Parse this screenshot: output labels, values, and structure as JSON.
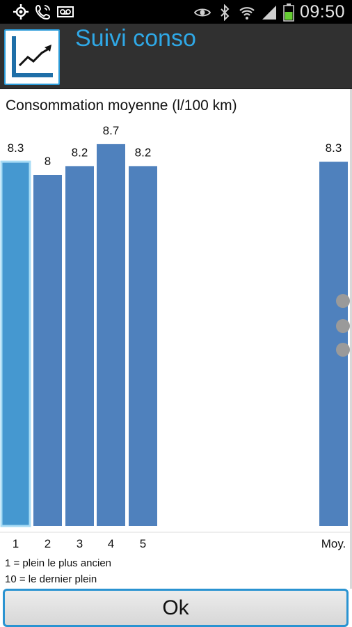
{
  "status_bar": {
    "time": "09:50",
    "icons_left": [
      "gps-icon",
      "call-icon",
      "voicemail-icon"
    ],
    "icons_right": [
      "eye-icon",
      "bluetooth-icon",
      "wifi-icon",
      "signal-icon",
      "battery-icon"
    ]
  },
  "app": {
    "title": "Suivi conso",
    "icon": "chart-trend-icon",
    "accent_color": "#2fa8e6"
  },
  "chart_data": {
    "type": "bar",
    "title": "Consommation moyenne (l/100 km)",
    "categories": [
      "1",
      "2",
      "3",
      "4",
      "5",
      "Moy."
    ],
    "values": [
      8.3,
      8,
      8.2,
      8.7,
      8.2,
      8.3
    ],
    "value_labels": [
      "8.3",
      "8",
      "8.2",
      "8.7",
      "8.2",
      "8.3"
    ],
    "highlighted_index": 0,
    "colors": {
      "bar": "#4f81bd",
      "highlight": "#4598d0",
      "highlight_border": "#a8dcf5"
    }
  },
  "notes": {
    "line1": "1 = plein le plus ancien",
    "line2": "10 = le dernier plein"
  },
  "ok_button": {
    "label": "Ok"
  }
}
